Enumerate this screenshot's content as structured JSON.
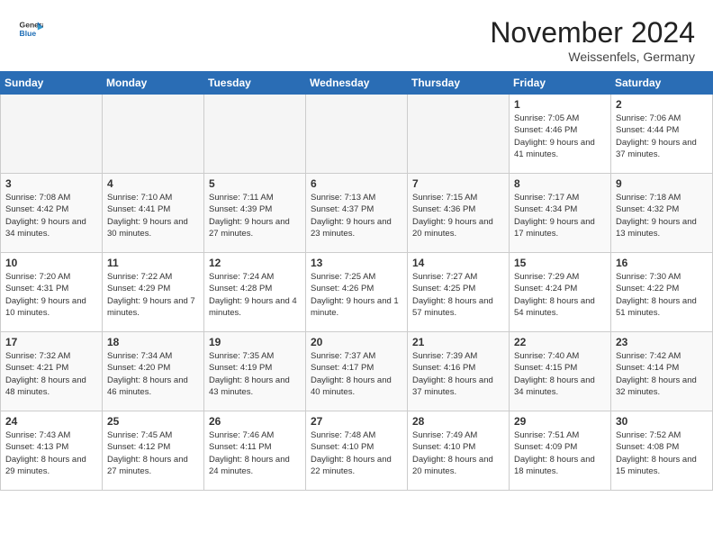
{
  "header": {
    "logo_general": "General",
    "logo_blue": "Blue",
    "month_title": "November 2024",
    "location": "Weissenfels, Germany"
  },
  "weekdays": [
    "Sunday",
    "Monday",
    "Tuesday",
    "Wednesday",
    "Thursday",
    "Friday",
    "Saturday"
  ],
  "weeks": [
    [
      {
        "day": "",
        "info": ""
      },
      {
        "day": "",
        "info": ""
      },
      {
        "day": "",
        "info": ""
      },
      {
        "day": "",
        "info": ""
      },
      {
        "day": "",
        "info": ""
      },
      {
        "day": "1",
        "info": "Sunrise: 7:05 AM\nSunset: 4:46 PM\nDaylight: 9 hours and 41 minutes."
      },
      {
        "day": "2",
        "info": "Sunrise: 7:06 AM\nSunset: 4:44 PM\nDaylight: 9 hours and 37 minutes."
      }
    ],
    [
      {
        "day": "3",
        "info": "Sunrise: 7:08 AM\nSunset: 4:42 PM\nDaylight: 9 hours and 34 minutes."
      },
      {
        "day": "4",
        "info": "Sunrise: 7:10 AM\nSunset: 4:41 PM\nDaylight: 9 hours and 30 minutes."
      },
      {
        "day": "5",
        "info": "Sunrise: 7:11 AM\nSunset: 4:39 PM\nDaylight: 9 hours and 27 minutes."
      },
      {
        "day": "6",
        "info": "Sunrise: 7:13 AM\nSunset: 4:37 PM\nDaylight: 9 hours and 23 minutes."
      },
      {
        "day": "7",
        "info": "Sunrise: 7:15 AM\nSunset: 4:36 PM\nDaylight: 9 hours and 20 minutes."
      },
      {
        "day": "8",
        "info": "Sunrise: 7:17 AM\nSunset: 4:34 PM\nDaylight: 9 hours and 17 minutes."
      },
      {
        "day": "9",
        "info": "Sunrise: 7:18 AM\nSunset: 4:32 PM\nDaylight: 9 hours and 13 minutes."
      }
    ],
    [
      {
        "day": "10",
        "info": "Sunrise: 7:20 AM\nSunset: 4:31 PM\nDaylight: 9 hours and 10 minutes."
      },
      {
        "day": "11",
        "info": "Sunrise: 7:22 AM\nSunset: 4:29 PM\nDaylight: 9 hours and 7 minutes."
      },
      {
        "day": "12",
        "info": "Sunrise: 7:24 AM\nSunset: 4:28 PM\nDaylight: 9 hours and 4 minutes."
      },
      {
        "day": "13",
        "info": "Sunrise: 7:25 AM\nSunset: 4:26 PM\nDaylight: 9 hours and 1 minute."
      },
      {
        "day": "14",
        "info": "Sunrise: 7:27 AM\nSunset: 4:25 PM\nDaylight: 8 hours and 57 minutes."
      },
      {
        "day": "15",
        "info": "Sunrise: 7:29 AM\nSunset: 4:24 PM\nDaylight: 8 hours and 54 minutes."
      },
      {
        "day": "16",
        "info": "Sunrise: 7:30 AM\nSunset: 4:22 PM\nDaylight: 8 hours and 51 minutes."
      }
    ],
    [
      {
        "day": "17",
        "info": "Sunrise: 7:32 AM\nSunset: 4:21 PM\nDaylight: 8 hours and 48 minutes."
      },
      {
        "day": "18",
        "info": "Sunrise: 7:34 AM\nSunset: 4:20 PM\nDaylight: 8 hours and 46 minutes."
      },
      {
        "day": "19",
        "info": "Sunrise: 7:35 AM\nSunset: 4:19 PM\nDaylight: 8 hours and 43 minutes."
      },
      {
        "day": "20",
        "info": "Sunrise: 7:37 AM\nSunset: 4:17 PM\nDaylight: 8 hours and 40 minutes."
      },
      {
        "day": "21",
        "info": "Sunrise: 7:39 AM\nSunset: 4:16 PM\nDaylight: 8 hours and 37 minutes."
      },
      {
        "day": "22",
        "info": "Sunrise: 7:40 AM\nSunset: 4:15 PM\nDaylight: 8 hours and 34 minutes."
      },
      {
        "day": "23",
        "info": "Sunrise: 7:42 AM\nSunset: 4:14 PM\nDaylight: 8 hours and 32 minutes."
      }
    ],
    [
      {
        "day": "24",
        "info": "Sunrise: 7:43 AM\nSunset: 4:13 PM\nDaylight: 8 hours and 29 minutes."
      },
      {
        "day": "25",
        "info": "Sunrise: 7:45 AM\nSunset: 4:12 PM\nDaylight: 8 hours and 27 minutes."
      },
      {
        "day": "26",
        "info": "Sunrise: 7:46 AM\nSunset: 4:11 PM\nDaylight: 8 hours and 24 minutes."
      },
      {
        "day": "27",
        "info": "Sunrise: 7:48 AM\nSunset: 4:10 PM\nDaylight: 8 hours and 22 minutes."
      },
      {
        "day": "28",
        "info": "Sunrise: 7:49 AM\nSunset: 4:10 PM\nDaylight: 8 hours and 20 minutes."
      },
      {
        "day": "29",
        "info": "Sunrise: 7:51 AM\nSunset: 4:09 PM\nDaylight: 8 hours and 18 minutes."
      },
      {
        "day": "30",
        "info": "Sunrise: 7:52 AM\nSunset: 4:08 PM\nDaylight: 8 hours and 15 minutes."
      }
    ]
  ]
}
